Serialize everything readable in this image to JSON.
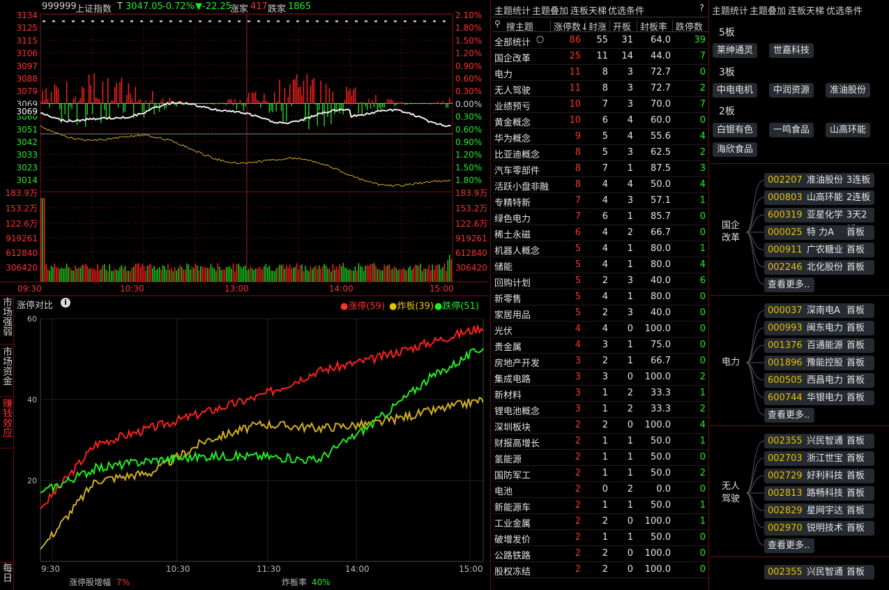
{
  "index_header": {
    "code": "999999",
    "name": "上证指数",
    "flag": "T",
    "price": "3047.05",
    "pct": "-0.72%",
    "change": "▼-22.25",
    "up_label": "涨家",
    "up_count": "417",
    "down_label": "跌家",
    "down_count": "1865"
  },
  "price_axis_left": [
    "3134",
    "3125",
    "3115",
    "3106",
    "3097",
    "3088",
    "3079",
    "3069",
    "3060",
    "3051",
    "3042",
    "3033",
    "3023",
    "3014"
  ],
  "price_axis_right": [
    "2.10%",
    "1.80%",
    "1.50%",
    "1.20%",
    "0.90%",
    "0.60%",
    "0.30%",
    "0.00%",
    "0.30%",
    "0.60%",
    "0.90%",
    "1.20%",
    "1.50%",
    "1.80%"
  ],
  "volume_axis": [
    "183.9万",
    "153.2万",
    "122.6万",
    "919261",
    "612840",
    "306420"
  ],
  "time_axis": [
    "09:30",
    "10:30",
    "13:00",
    "14:00",
    "15:00"
  ],
  "left_tabs": [
    "市场强弱",
    "市场资金",
    "赚钱效应"
  ],
  "left_tab_bottom": "每日",
  "compare": {
    "title": "涨停对比",
    "legend": [
      "涨停(59)",
      "炸板(39)",
      "跌停(51)"
    ],
    "y_ticks": [
      "60",
      "40",
      "20"
    ],
    "x_ticks": [
      "9:30",
      "10:30",
      "11:30",
      "14:00",
      "15:00"
    ],
    "footer_left_label": "涨停股增幅",
    "footer_left_value": "7%",
    "footer_right_label": "炸板率",
    "footer_right_value": "40%"
  },
  "chart_data": [
    {
      "type": "line",
      "title": "涨停对比",
      "series": [
        {
          "name": "涨停(59)",
          "color": "#ff2020",
          "x": [
            "9:30",
            "10:00",
            "10:30",
            "11:00",
            "11:30",
            "13:30",
            "14:00",
            "14:30",
            "15:00"
          ],
          "values": [
            13,
            29,
            33,
            37,
            41,
            47,
            50,
            54,
            58
          ]
        },
        {
          "name": "炸板(39)",
          "color": "#d4b020",
          "x": [
            "9:30",
            "10:00",
            "10:30",
            "11:00",
            "11:30",
            "13:30",
            "14:00",
            "14:30",
            "15:00"
          ],
          "values": [
            3,
            20,
            22,
            30,
            34,
            33,
            34,
            37,
            40
          ]
        },
        {
          "name": "跌停(51)",
          "color": "#22ee22",
          "x": [
            "9:30",
            "10:00",
            "10:30",
            "11:00",
            "11:30",
            "13:30",
            "14:00",
            "14:30",
            "15:00"
          ],
          "values": [
            17,
            23,
            25,
            26,
            26,
            25,
            34,
            45,
            53
          ]
        }
      ],
      "ylim": [
        0,
        60
      ]
    }
  ],
  "mid_tabs": [
    "主题统计",
    "主题叠加",
    "连板天梯",
    "优选条件"
  ],
  "mid_help": "?",
  "table_headers": [
    "搜主题",
    "涨停数↓",
    "封涨",
    "开板",
    "封板率",
    "跌停数"
  ],
  "table_rows": [
    [
      "全部统计",
      "86",
      "55",
      "31",
      "64.0",
      "39"
    ],
    [
      "国企改革",
      "25",
      "11",
      "14",
      "44.0",
      "7"
    ],
    [
      "电力",
      "11",
      "8",
      "3",
      "72.7",
      "0"
    ],
    [
      "无人驾驶",
      "11",
      "8",
      "3",
      "72.7",
      "2"
    ],
    [
      "业绩预亏",
      "10",
      "7",
      "3",
      "70.0",
      "7"
    ],
    [
      "黄金概念",
      "10",
      "6",
      "4",
      "60.0",
      "0"
    ],
    [
      "华为概念",
      "9",
      "5",
      "4",
      "55.6",
      "4"
    ],
    [
      "比亚迪概念",
      "8",
      "5",
      "3",
      "62.5",
      "2"
    ],
    [
      "汽车零部件",
      "8",
      "7",
      "1",
      "87.5",
      "3"
    ],
    [
      "活跃小盘非融",
      "8",
      "4",
      "4",
      "50.0",
      "4"
    ],
    [
      "专精特新",
      "7",
      "4",
      "3",
      "57.1",
      "1"
    ],
    [
      "绿色电力",
      "7",
      "6",
      "1",
      "85.7",
      "0"
    ],
    [
      "稀土永磁",
      "6",
      "4",
      "2",
      "66.7",
      "0"
    ],
    [
      "机器人概念",
      "5",
      "4",
      "1",
      "80.0",
      "1"
    ],
    [
      "储能",
      "5",
      "4",
      "1",
      "80.0",
      "4"
    ],
    [
      "回购计划",
      "5",
      "2",
      "3",
      "40.0",
      "6"
    ],
    [
      "新零售",
      "5",
      "4",
      "1",
      "80.0",
      "0"
    ],
    [
      "家居用品",
      "5",
      "2",
      "3",
      "40.0",
      "0"
    ],
    [
      "光伏",
      "4",
      "4",
      "0",
      "100.0",
      "0"
    ],
    [
      "贵金属",
      "4",
      "3",
      "1",
      "75.0",
      "0"
    ],
    [
      "房地产开发",
      "3",
      "2",
      "1",
      "66.7",
      "0"
    ],
    [
      "集成电路",
      "3",
      "3",
      "0",
      "100.0",
      "2"
    ],
    [
      "新材料",
      "3",
      "1",
      "2",
      "33.3",
      "1"
    ],
    [
      "锂电池概念",
      "3",
      "1",
      "2",
      "33.3",
      "2"
    ],
    [
      "深圳板块",
      "2",
      "2",
      "0",
      "100.0",
      "4"
    ],
    [
      "财报高增长",
      "2",
      "1",
      "1",
      "50.0",
      "1"
    ],
    [
      "氢能源",
      "2",
      "1",
      "1",
      "50.0",
      "0"
    ],
    [
      "国防军工",
      "2",
      "1",
      "1",
      "50.0",
      "2"
    ],
    [
      "电池",
      "2",
      "0",
      "2",
      "0.0",
      "0"
    ],
    [
      "新能源车",
      "2",
      "1",
      "1",
      "50.0",
      "1"
    ],
    [
      "工业金属",
      "2",
      "2",
      "0",
      "100.0",
      "1"
    ],
    [
      "破增发价",
      "2",
      "1",
      "1",
      "50.0",
      "0"
    ],
    [
      "公路铁路",
      "2",
      "2",
      "0",
      "100.0",
      "0"
    ],
    [
      "股权冻结",
      "2",
      "2",
      "0",
      "100.0",
      "0"
    ]
  ],
  "right_tabs": [
    "主题统计",
    "主题叠加",
    "连板天梯",
    "优选条件"
  ],
  "ladder": [
    {
      "level": "5板",
      "stocks": [
        "莱绅通灵",
        "世嘉科技"
      ]
    },
    {
      "level": "3板",
      "stocks": [
        "中电电机",
        "中润资源",
        "准油股份"
      ]
    },
    {
      "level": "2板",
      "stocks": [
        "白银有色",
        "一鸣食品",
        "山高环能",
        "海欣食品"
      ]
    }
  ],
  "groups": [
    {
      "name": "国企改革",
      "name_lines": [
        "国企",
        "改革"
      ],
      "items": [
        [
          "002207",
          "准油股份",
          "3连板"
        ],
        [
          "000803",
          "山高环能",
          "2连板"
        ],
        [
          "600319",
          "亚星化学",
          "3天2板"
        ],
        [
          "000025",
          "特 力A",
          "首板"
        ],
        [
          "000911",
          "广农糖业",
          "首板"
        ],
        [
          "002246",
          "北化股份",
          "首板"
        ]
      ],
      "more": "查看更多.."
    },
    {
      "name": "电力",
      "name_lines": [
        "电力"
      ],
      "items": [
        [
          "000037",
          "深南电A",
          "首板"
        ],
        [
          "000993",
          "闽东电力",
          "首板"
        ],
        [
          "001376",
          "百通能源",
          "首板"
        ],
        [
          "001896",
          "豫能控股",
          "首板"
        ],
        [
          "600505",
          "西昌电力",
          "首板"
        ],
        [
          "600744",
          "华银电力",
          "首板"
        ]
      ],
      "more": "查看更多.."
    },
    {
      "name": "无人驾驶",
      "name_lines": [
        "无人",
        "驾驶"
      ],
      "items": [
        [
          "002355",
          "兴民智通",
          "首板"
        ],
        [
          "002703",
          "浙江世宝",
          "首板"
        ],
        [
          "002729",
          "好利科技",
          "首板"
        ],
        [
          "002813",
          "路畅科技",
          "首板"
        ],
        [
          "002829",
          "星网宇达",
          "首板"
        ],
        [
          "002970",
          "锐明技术",
          "首板"
        ]
      ],
      "more": "查看更多.."
    },
    {
      "name": "",
      "name_lines": [],
      "items": [
        [
          "002355",
          "兴民智通",
          "首板"
        ]
      ],
      "more": ""
    }
  ]
}
